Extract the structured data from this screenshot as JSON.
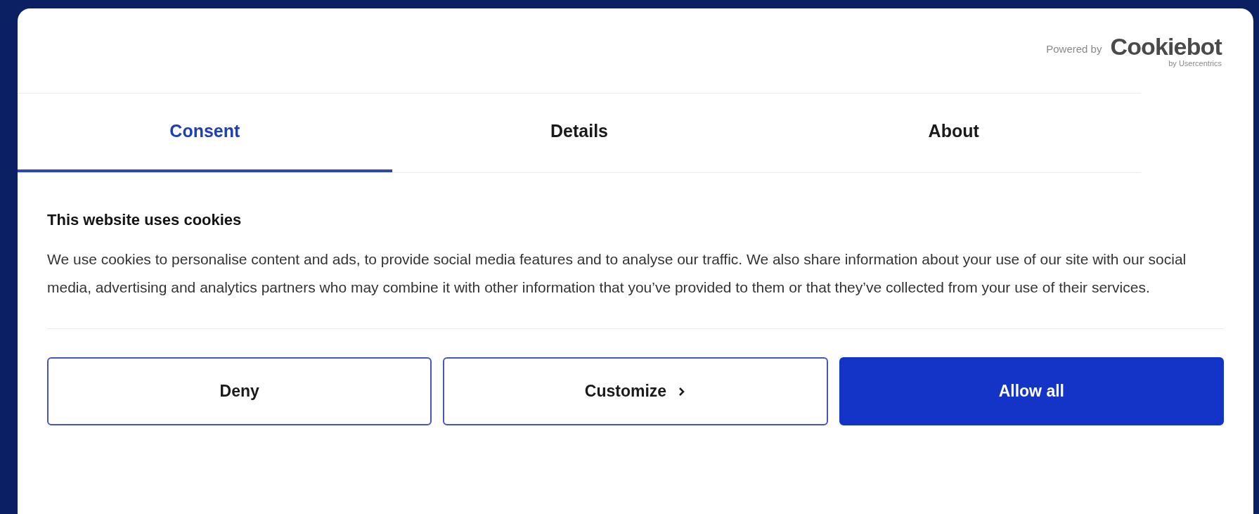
{
  "header": {
    "powered_by": "Powered by",
    "brand": "Cookiebot",
    "brand_sub": "by Usercentrics"
  },
  "tabs": [
    {
      "label": "Consent",
      "selected": true
    },
    {
      "label": "Details",
      "selected": false
    },
    {
      "label": "About",
      "selected": false
    }
  ],
  "title": "This website uses cookies",
  "body": "We use cookies to personalise content and ads, to provide social media features and to analyse our traffic. We also share information about your use of our site with our social media, advertising and analytics partners who may combine it with other information that you’ve provided to them or that they’ve collected from your use of their services.",
  "buttons": [
    {
      "label": "Deny",
      "kind": "outline"
    },
    {
      "label": "Customize",
      "kind": "chevron"
    },
    {
      "label": "Allow all",
      "kind": "primary"
    }
  ]
}
